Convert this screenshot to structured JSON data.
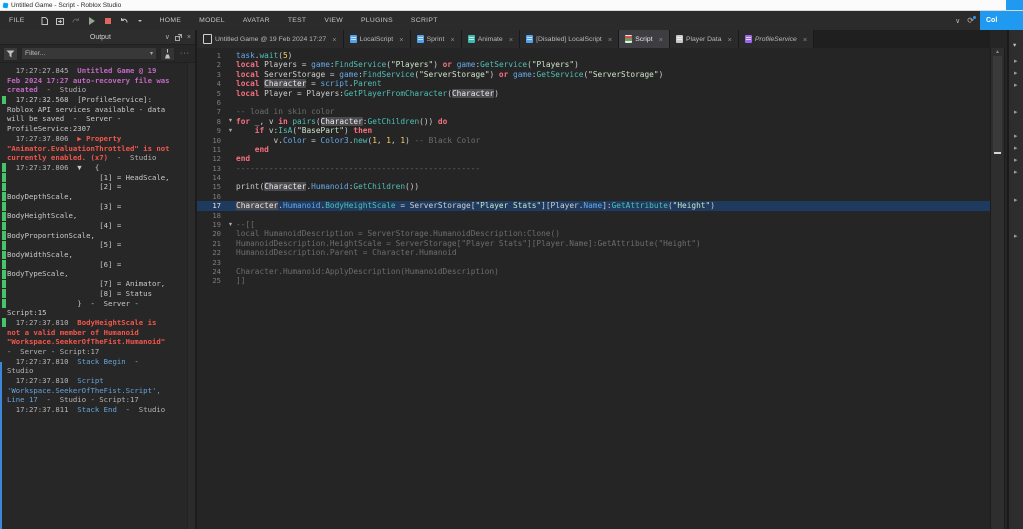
{
  "title_bar": {
    "title": "Untitled Game - Script - Roblox Studio"
  },
  "menu_bar": {
    "file_label": "FILE",
    "items": [
      "HOME",
      "MODEL",
      "AVATAR",
      "TEST",
      "VIEW",
      "PLUGINS",
      "SCRIPT"
    ],
    "collab_button_label": "Col",
    "icons": [
      "new-file-icon",
      "insert-icon",
      "redo-icon",
      "play-icon",
      "stop-icon",
      "undo-icon",
      "dropdown-caret-icon"
    ]
  },
  "tabs": [
    {
      "label": "Untitled Game @ 19 Feb 2024 17:27",
      "icon": "place-icon",
      "icon_style": "outline",
      "icon_color": "",
      "active": false,
      "italic": false,
      "close": "×"
    },
    {
      "label": "LocalScript",
      "icon": "localscript-icon",
      "icon_style": "fill",
      "icon_color": "#53a2e8",
      "active": false,
      "italic": false,
      "close": "×"
    },
    {
      "label": "Sprint",
      "icon": "localscript-icon",
      "icon_style": "fill",
      "icon_color": "#53a2e8",
      "active": false,
      "italic": false,
      "close": "×"
    },
    {
      "label": "Animate",
      "icon": "localscript-icon",
      "icon_style": "fill",
      "icon_color": "#3fb8ae",
      "active": false,
      "italic": false,
      "close": "×"
    },
    {
      "label": "[Disabled] LocalScript",
      "icon": "localscript-icon",
      "icon_style": "fill",
      "icon_color": "#53a2e8",
      "active": false,
      "italic": false,
      "close": "×"
    },
    {
      "label": "Script",
      "icon": "script-icon",
      "icon_style": "script",
      "icon_color": "",
      "active": true,
      "italic": false,
      "close": "×"
    },
    {
      "label": "Player Data",
      "icon": "modulescript-icon",
      "icon_style": "fill",
      "icon_color": "#c9c9c9",
      "active": false,
      "italic": false,
      "close": "×"
    },
    {
      "label": "ProfileService",
      "icon": "modulescript-icon",
      "icon_style": "fill",
      "icon_color": "#9a68e8",
      "active": false,
      "italic": true,
      "close": "×"
    }
  ],
  "output": {
    "title": "Output",
    "header_icons": [
      "collapse-chevron-icon",
      "popout-icon",
      "close-icon"
    ],
    "filter_placeholder": "Filter...",
    "lines": [
      {
        "bar": false,
        "segs": [
          [
            "  17:27:27.845  ",
            "ts"
          ],
          [
            "Untitled Game @ 19",
            "mg"
          ]
        ]
      },
      {
        "bar": false,
        "segs": [
          [
            "Feb 2024 17:27 auto-recovery file was",
            "mg"
          ]
        ]
      },
      {
        "bar": false,
        "segs": [
          [
            "created",
            "mg"
          ],
          [
            "  -  Studio",
            "ts"
          ]
        ]
      },
      {
        "bar": true,
        "segs": [
          [
            "  17:27:32.568  [ProfileService]:",
            "df"
          ]
        ]
      },
      {
        "bar": false,
        "segs": [
          [
            "Roblox API services available - data",
            "df"
          ]
        ]
      },
      {
        "bar": false,
        "segs": [
          [
            "will be saved  -  Server -",
            "df"
          ]
        ]
      },
      {
        "bar": false,
        "segs": [
          [
            "ProfileService:2307",
            "df"
          ]
        ]
      },
      {
        "bar": false,
        "segs": [
          [
            "  17:27:37.806  ",
            "ts"
          ],
          [
            "▶ Property",
            "rd"
          ]
        ]
      },
      {
        "bar": false,
        "segs": [
          [
            "\"Animator.EvaluationThrottled\" is not",
            "rd"
          ]
        ]
      },
      {
        "bar": false,
        "segs": [
          [
            "currently enabled. (x7)",
            "rd"
          ],
          [
            "  -  Studio",
            "ts"
          ]
        ]
      },
      {
        "bar": true,
        "segs": [
          [
            "  17:27:37.806  ",
            "ts"
          ],
          [
            "▼   {",
            "df"
          ]
        ]
      },
      {
        "bar": true,
        "segs": [
          [
            "                     [1] = HeadScale,",
            "df"
          ]
        ]
      },
      {
        "bar": true,
        "segs": [
          [
            "                     [2] =",
            "df"
          ]
        ]
      },
      {
        "bar": true,
        "segs": [
          [
            "BodyDepthScale,",
            "df"
          ]
        ]
      },
      {
        "bar": true,
        "segs": [
          [
            "                     [3] =",
            "df"
          ]
        ]
      },
      {
        "bar": true,
        "segs": [
          [
            "BodyHeightScale,",
            "df"
          ]
        ]
      },
      {
        "bar": true,
        "segs": [
          [
            "                     [4] =",
            "df"
          ]
        ]
      },
      {
        "bar": true,
        "segs": [
          [
            "BodyProportionScale,",
            "df"
          ]
        ]
      },
      {
        "bar": true,
        "segs": [
          [
            "                     [5] =",
            "df"
          ]
        ]
      },
      {
        "bar": true,
        "segs": [
          [
            "BodyWidthScale,",
            "df"
          ]
        ]
      },
      {
        "bar": true,
        "segs": [
          [
            "                     [6] =",
            "df"
          ]
        ]
      },
      {
        "bar": true,
        "segs": [
          [
            "BodyTypeScale,",
            "df"
          ]
        ]
      },
      {
        "bar": true,
        "segs": [
          [
            "                     [7] = Animator,",
            "df"
          ]
        ]
      },
      {
        "bar": true,
        "segs": [
          [
            "                     [8] = Status",
            "df"
          ]
        ]
      },
      {
        "bar": true,
        "segs": [
          [
            "                }  -  Server -",
            "df"
          ]
        ]
      },
      {
        "bar": false,
        "segs": [
          [
            "Script:15",
            "df"
          ]
        ]
      },
      {
        "bar": true,
        "segs": [
          [
            "  17:27:37.810  ",
            "ts"
          ],
          [
            "BodyHeightScale is",
            "rd"
          ]
        ]
      },
      {
        "bar": false,
        "segs": [
          [
            "not a valid member of Humanoid",
            "rd"
          ]
        ]
      },
      {
        "bar": false,
        "segs": [
          [
            "\"Workspace.SeekerOfTheFist.Humanoid\"",
            "rd"
          ]
        ]
      },
      {
        "bar": false,
        "segs": [
          [
            "-  Server - Script:17",
            "ts"
          ]
        ]
      },
      {
        "bar": false,
        "segs": [
          [
            "  17:27:37.810  ",
            "ts"
          ],
          [
            "Stack Begin",
            "bl"
          ],
          [
            "  -",
            "ts"
          ]
        ]
      },
      {
        "bar": false,
        "segs": [
          [
            "Studio",
            "ts"
          ]
        ]
      },
      {
        "bar": false,
        "segs": [
          [
            "  17:27:37.810  ",
            "ts"
          ],
          [
            "Script",
            "bl"
          ]
        ]
      },
      {
        "bar": false,
        "segs": [
          [
            "'Workspace.SeekerOfTheFist.Script',",
            "bl"
          ]
        ]
      },
      {
        "bar": false,
        "segs": [
          [
            "Line 17",
            "bl"
          ],
          [
            "  -  Studio - Script:17",
            "ts"
          ]
        ]
      },
      {
        "bar": false,
        "segs": [
          [
            "  17:27:37.811  ",
            "ts"
          ],
          [
            "Stack End",
            "bl"
          ],
          [
            "  -  Studio",
            "ts"
          ]
        ]
      }
    ]
  },
  "editor": {
    "current_line": 17,
    "lines": [
      {
        "n": 1,
        "fold": false,
        "tokens": [
          [
            "task",
            "bi"
          ],
          [
            ".",
            "tx"
          ],
          [
            "wait",
            "me"
          ],
          [
            "(",
            "tx"
          ],
          [
            "5",
            "nu"
          ],
          [
            ")",
            "tx"
          ]
        ]
      },
      {
        "n": 2,
        "fold": false,
        "tokens": [
          [
            "local ",
            "kw"
          ],
          [
            "Players = ",
            "tx"
          ],
          [
            "game",
            "bi"
          ],
          [
            ":",
            "tx"
          ],
          [
            "FindService",
            "me"
          ],
          [
            "(",
            "tx"
          ],
          [
            "\"Players\"",
            "st"
          ],
          [
            ") ",
            "tx"
          ],
          [
            "or",
            "kw"
          ],
          [
            " ",
            "tx"
          ],
          [
            "game",
            "bi"
          ],
          [
            ":",
            "tx"
          ],
          [
            "GetService",
            "me"
          ],
          [
            "(",
            "tx"
          ],
          [
            "\"Players\"",
            "st"
          ],
          [
            ")",
            "tx"
          ]
        ]
      },
      {
        "n": 3,
        "fold": false,
        "tokens": [
          [
            "local ",
            "kw"
          ],
          [
            "ServerStorage = ",
            "tx"
          ],
          [
            "game",
            "bi"
          ],
          [
            ":",
            "tx"
          ],
          [
            "FindService",
            "me"
          ],
          [
            "(",
            "tx"
          ],
          [
            "\"ServerStorage\"",
            "st"
          ],
          [
            ") ",
            "tx"
          ],
          [
            "or",
            "kw"
          ],
          [
            " ",
            "tx"
          ],
          [
            "game",
            "bi"
          ],
          [
            ":",
            "tx"
          ],
          [
            "GetService",
            "me"
          ],
          [
            "(",
            "tx"
          ],
          [
            "\"ServerStorage\"",
            "st"
          ],
          [
            ")",
            "tx"
          ]
        ]
      },
      {
        "n": 4,
        "fold": false,
        "tokens": [
          [
            "local ",
            "kw"
          ],
          [
            "Character",
            "sel"
          ],
          [
            " = ",
            "tx"
          ],
          [
            "script",
            "bi"
          ],
          [
            ".",
            "tx"
          ],
          [
            "Parent",
            "me"
          ]
        ]
      },
      {
        "n": 5,
        "fold": false,
        "tokens": [
          [
            "local ",
            "kw"
          ],
          [
            "Player = Players:",
            "tx"
          ],
          [
            "GetPlayerFromCharacter",
            "me"
          ],
          [
            "(",
            "tx"
          ],
          [
            "Character",
            "sel"
          ],
          [
            ")",
            "tx"
          ]
        ]
      },
      {
        "n": 6,
        "fold": false,
        "tokens": []
      },
      {
        "n": 7,
        "fold": false,
        "tokens": [
          [
            "-- load in skin color",
            "co"
          ]
        ]
      },
      {
        "n": 8,
        "fold": true,
        "tokens": [
          [
            "for",
            "kw"
          ],
          [
            " _, v ",
            "tx"
          ],
          [
            "in",
            "kw"
          ],
          [
            " ",
            "tx"
          ],
          [
            "pairs",
            "me"
          ],
          [
            "(",
            "tx"
          ],
          [
            "Character",
            "sel"
          ],
          [
            ":",
            "tx"
          ],
          [
            "GetChildren",
            "me"
          ],
          [
            "()) ",
            "tx"
          ],
          [
            "do",
            "kw"
          ]
        ]
      },
      {
        "n": 9,
        "fold": true,
        "tokens": [
          [
            "    ",
            "tx"
          ],
          [
            "if",
            "kw"
          ],
          [
            " v:",
            "tx"
          ],
          [
            "IsA",
            "me"
          ],
          [
            "(",
            "tx"
          ],
          [
            "\"BasePart\"",
            "st"
          ],
          [
            ") ",
            "tx"
          ],
          [
            "then",
            "kw"
          ]
        ]
      },
      {
        "n": 10,
        "fold": false,
        "tokens": [
          [
            "        v.",
            "tx"
          ],
          [
            "Color",
            "bi"
          ],
          [
            " = ",
            "tx"
          ],
          [
            "Color3",
            "bi"
          ],
          [
            ".",
            "tx"
          ],
          [
            "new",
            "me"
          ],
          [
            "(",
            "tx"
          ],
          [
            "1",
            "nu"
          ],
          [
            ", ",
            "tx"
          ],
          [
            "1",
            "nu"
          ],
          [
            ", ",
            "tx"
          ],
          [
            "1",
            "nu"
          ],
          [
            ") ",
            "tx"
          ],
          [
            "-- Black Color",
            "co"
          ]
        ]
      },
      {
        "n": 11,
        "fold": false,
        "tokens": [
          [
            "    ",
            "tx"
          ],
          [
            "end",
            "kw"
          ]
        ]
      },
      {
        "n": 12,
        "fold": false,
        "tokens": [
          [
            "end",
            "kw"
          ]
        ]
      },
      {
        "n": 13,
        "fold": false,
        "tokens": [
          [
            "----------------------------------------------------",
            "co"
          ]
        ]
      },
      {
        "n": 14,
        "fold": false,
        "tokens": []
      },
      {
        "n": 15,
        "fold": false,
        "tokens": [
          [
            "print",
            "tx"
          ],
          [
            "(",
            "tx"
          ],
          [
            "Character",
            "sel"
          ],
          [
            ".",
            "tx"
          ],
          [
            "Humanoid",
            "bi"
          ],
          [
            ":",
            "tx"
          ],
          [
            "GetChildren",
            "me"
          ],
          [
            "())",
            "tx"
          ]
        ]
      },
      {
        "n": 16,
        "fold": false,
        "tokens": []
      },
      {
        "n": 17,
        "fold": false,
        "tokens": [
          [
            "Character",
            "sel"
          ],
          [
            ".",
            "tx"
          ],
          [
            "Humanoid",
            "bi"
          ],
          [
            ".",
            "tx"
          ],
          [
            "BodyHeightScale",
            "me"
          ],
          [
            " = ServerStorage[",
            "tx"
          ],
          [
            "\"Player Stats\"",
            "st"
          ],
          [
            "][Player.",
            "tx"
          ],
          [
            "Name",
            "bi"
          ],
          [
            "]:",
            "tx"
          ],
          [
            "GetAttribute",
            "me"
          ],
          [
            "(",
            "tx"
          ],
          [
            "\"Height\"",
            "st"
          ],
          [
            ")",
            "tx"
          ]
        ]
      },
      {
        "n": 18,
        "fold": false,
        "tokens": []
      },
      {
        "n": 19,
        "fold": true,
        "tokens": [
          [
            "--[[",
            "co"
          ]
        ]
      },
      {
        "n": 20,
        "fold": false,
        "tokens": [
          [
            "local HumanoidDescription = ServerStorage.HumanoidDescription:Clone()",
            "co"
          ]
        ]
      },
      {
        "n": 21,
        "fold": false,
        "tokens": [
          [
            "HumanoidDescription.HeightScale = ServerStorage[\"Player Stats\"][Player.Name]:GetAttribute(\"Height\")",
            "co"
          ]
        ]
      },
      {
        "n": 22,
        "fold": false,
        "tokens": [
          [
            "HumanoidDescription.Parent = Character.Humanoid",
            "co"
          ]
        ]
      },
      {
        "n": 23,
        "fold": false,
        "tokens": []
      },
      {
        "n": 24,
        "fold": false,
        "tokens": [
          [
            "Character.Humanoid:ApplyDescription(HumanoidDescription)",
            "co"
          ]
        ]
      },
      {
        "n": 25,
        "fold": false,
        "tokens": [
          [
            "]]",
            "co"
          ]
        ]
      }
    ]
  },
  "right_panel": {
    "arrow_ys": [
      28,
      40,
      52,
      79,
      103,
      115,
      127,
      139,
      167,
      203
    ]
  },
  "colors": {
    "accent_blue": "#1f9af0",
    "error_red": "#f4564c",
    "info_magenta": "#c468c4",
    "stack_blue": "#66a3dc",
    "log_green_bar": "#46c46a",
    "current_line_bg": "#1e3a5e"
  }
}
